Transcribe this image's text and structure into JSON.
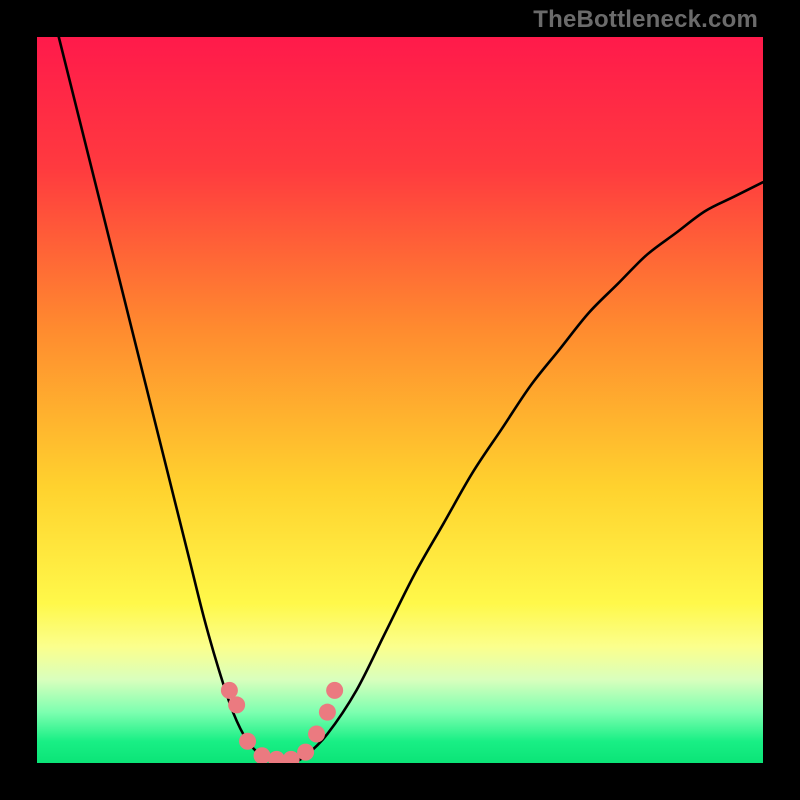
{
  "watermark": "TheBottleneck.com",
  "chart_data": {
    "type": "line",
    "title": "",
    "xlabel": "",
    "ylabel": "",
    "xlim": [
      0,
      100
    ],
    "ylim": [
      0,
      100
    ],
    "background_gradient_stops": [
      {
        "pos": 0.0,
        "color": "#ff1a4b"
      },
      {
        "pos": 0.18,
        "color": "#ff3a3f"
      },
      {
        "pos": 0.4,
        "color": "#ff8a2f"
      },
      {
        "pos": 0.62,
        "color": "#ffd22e"
      },
      {
        "pos": 0.78,
        "color": "#fff84a"
      },
      {
        "pos": 0.84,
        "color": "#fbff8d"
      },
      {
        "pos": 0.885,
        "color": "#d9ffbd"
      },
      {
        "pos": 0.93,
        "color": "#7dffb0"
      },
      {
        "pos": 0.97,
        "color": "#19ef85"
      },
      {
        "pos": 1.0,
        "color": "#0be477"
      }
    ],
    "series": [
      {
        "name": "bottleneck-curve",
        "color": "#000000",
        "x": [
          3,
          5,
          7,
          9,
          11,
          13,
          15,
          17,
          19,
          21,
          23,
          25,
          27,
          29,
          31,
          33,
          35,
          37,
          40,
          44,
          48,
          52,
          56,
          60,
          64,
          68,
          72,
          76,
          80,
          84,
          88,
          92,
          96,
          100
        ],
        "y": [
          100,
          92,
          84,
          76,
          68,
          60,
          52,
          44,
          36,
          28,
          20,
          13,
          7,
          3,
          1,
          0,
          0,
          1,
          4,
          10,
          18,
          26,
          33,
          40,
          46,
          52,
          57,
          62,
          66,
          70,
          73,
          76,
          78,
          80
        ]
      }
    ],
    "markers": {
      "name": "bottleneck-markers",
      "color": "#eb7a80",
      "points": [
        {
          "x": 26.5,
          "y": 10
        },
        {
          "x": 27.5,
          "y": 8
        },
        {
          "x": 29,
          "y": 3
        },
        {
          "x": 31,
          "y": 1
        },
        {
          "x": 33,
          "y": 0.5
        },
        {
          "x": 35,
          "y": 0.5
        },
        {
          "x": 37,
          "y": 1.5
        },
        {
          "x": 38.5,
          "y": 4
        },
        {
          "x": 40,
          "y": 7
        },
        {
          "x": 41,
          "y": 10
        }
      ]
    }
  }
}
